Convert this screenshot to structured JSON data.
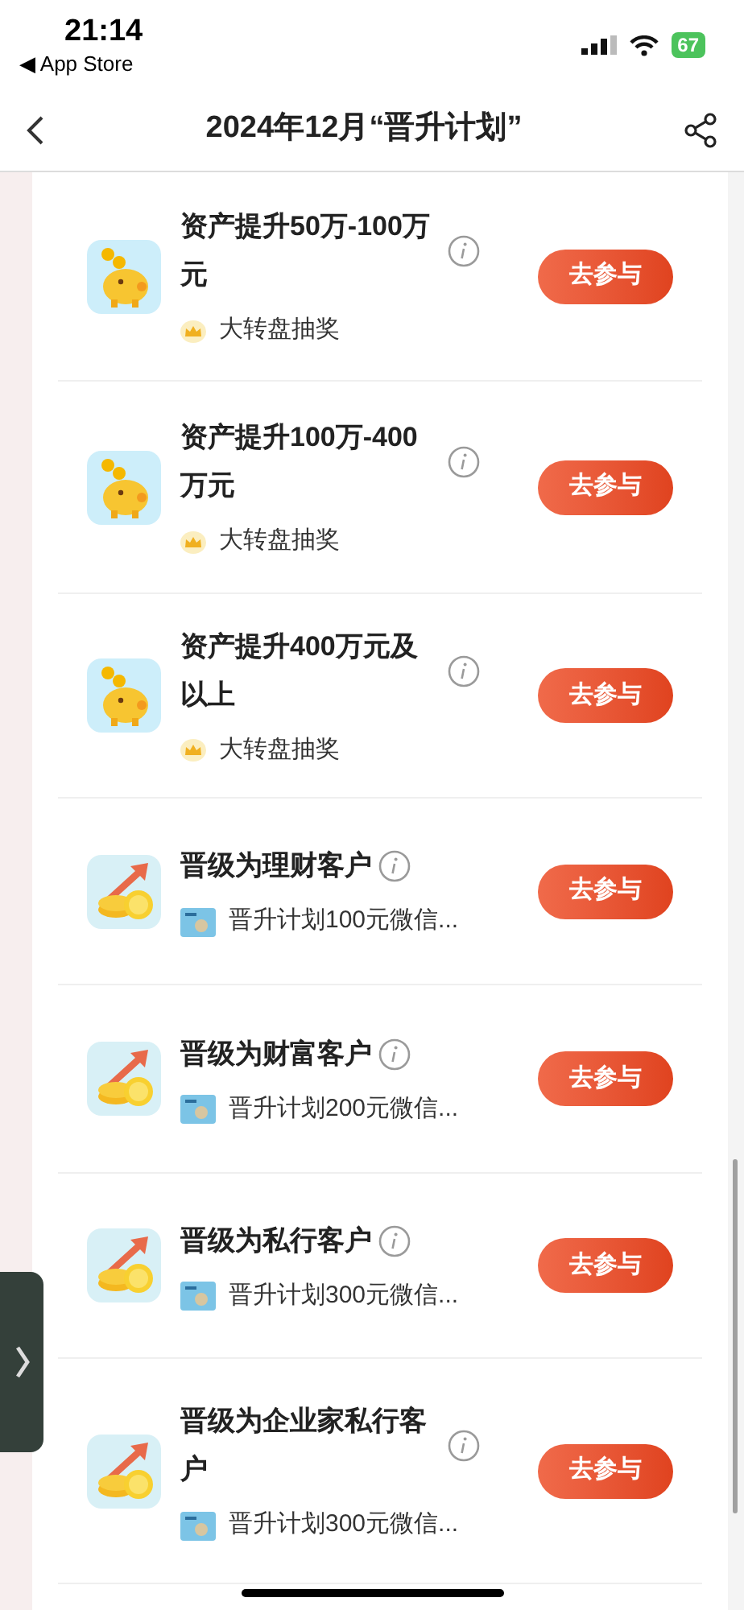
{
  "status_bar": {
    "time": "21:14",
    "back_app": "◀ App Store",
    "battery": "67"
  },
  "nav": {
    "title": "2024年12月“晋升计划”"
  },
  "tasks": [
    {
      "kind": "piggy",
      "title": "资产提升50万-100万元",
      "reward": {
        "kind": "crown",
        "text": "大转盘抽奖"
      },
      "button": "去参与"
    },
    {
      "kind": "piggy",
      "title": "资产提升100万-400万元",
      "reward": {
        "kind": "crown",
        "text": "大转盘抽奖"
      },
      "button": "去参与"
    },
    {
      "kind": "piggy",
      "title": "资产提升400万元及以上",
      "reward": {
        "kind": "crown",
        "text": "大转盘抽奖"
      },
      "button": "去参与"
    },
    {
      "kind": "coins",
      "title": "晋级为理财客户",
      "reward": {
        "kind": "card",
        "text": "晋升计划100元微信..."
      },
      "button": "去参与"
    },
    {
      "kind": "coins",
      "title": "晋级为财富客户",
      "reward": {
        "kind": "card",
        "text": "晋升计划200元微信..."
      },
      "button": "去参与"
    },
    {
      "kind": "coins",
      "title": "晋级为私行客户",
      "reward": {
        "kind": "card",
        "text": "晋升计划300元微信..."
      },
      "button": "去参与"
    },
    {
      "kind": "coins",
      "title": "晋级为企业家私行客户",
      "reward": {
        "kind": "card",
        "text": "晋升计划300元微信..."
      },
      "button": "去参与"
    }
  ]
}
